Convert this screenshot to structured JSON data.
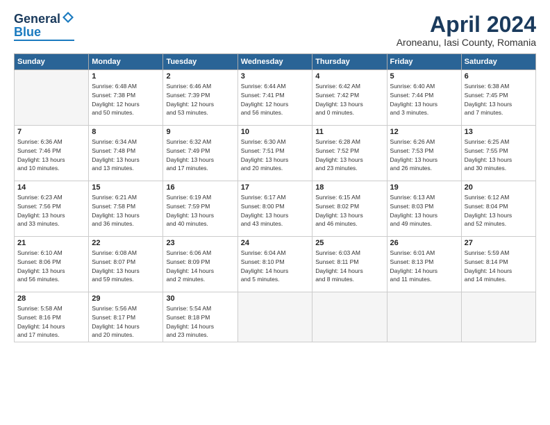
{
  "logo": {
    "general": "General",
    "blue": "Blue"
  },
  "header": {
    "title": "April 2024",
    "subtitle": "Aroneanu, Iasi County, Romania"
  },
  "days_of_week": [
    "Sunday",
    "Monday",
    "Tuesday",
    "Wednesday",
    "Thursday",
    "Friday",
    "Saturday"
  ],
  "weeks": [
    [
      {
        "day": "",
        "info": ""
      },
      {
        "day": "1",
        "info": "Sunrise: 6:48 AM\nSunset: 7:38 PM\nDaylight: 12 hours\nand 50 minutes."
      },
      {
        "day": "2",
        "info": "Sunrise: 6:46 AM\nSunset: 7:39 PM\nDaylight: 12 hours\nand 53 minutes."
      },
      {
        "day": "3",
        "info": "Sunrise: 6:44 AM\nSunset: 7:41 PM\nDaylight: 12 hours\nand 56 minutes."
      },
      {
        "day": "4",
        "info": "Sunrise: 6:42 AM\nSunset: 7:42 PM\nDaylight: 13 hours\nand 0 minutes."
      },
      {
        "day": "5",
        "info": "Sunrise: 6:40 AM\nSunset: 7:44 PM\nDaylight: 13 hours\nand 3 minutes."
      },
      {
        "day": "6",
        "info": "Sunrise: 6:38 AM\nSunset: 7:45 PM\nDaylight: 13 hours\nand 7 minutes."
      }
    ],
    [
      {
        "day": "7",
        "info": "Sunrise: 6:36 AM\nSunset: 7:46 PM\nDaylight: 13 hours\nand 10 minutes."
      },
      {
        "day": "8",
        "info": "Sunrise: 6:34 AM\nSunset: 7:48 PM\nDaylight: 13 hours\nand 13 minutes."
      },
      {
        "day": "9",
        "info": "Sunrise: 6:32 AM\nSunset: 7:49 PM\nDaylight: 13 hours\nand 17 minutes."
      },
      {
        "day": "10",
        "info": "Sunrise: 6:30 AM\nSunset: 7:51 PM\nDaylight: 13 hours\nand 20 minutes."
      },
      {
        "day": "11",
        "info": "Sunrise: 6:28 AM\nSunset: 7:52 PM\nDaylight: 13 hours\nand 23 minutes."
      },
      {
        "day": "12",
        "info": "Sunrise: 6:26 AM\nSunset: 7:53 PM\nDaylight: 13 hours\nand 26 minutes."
      },
      {
        "day": "13",
        "info": "Sunrise: 6:25 AM\nSunset: 7:55 PM\nDaylight: 13 hours\nand 30 minutes."
      }
    ],
    [
      {
        "day": "14",
        "info": "Sunrise: 6:23 AM\nSunset: 7:56 PM\nDaylight: 13 hours\nand 33 minutes."
      },
      {
        "day": "15",
        "info": "Sunrise: 6:21 AM\nSunset: 7:58 PM\nDaylight: 13 hours\nand 36 minutes."
      },
      {
        "day": "16",
        "info": "Sunrise: 6:19 AM\nSunset: 7:59 PM\nDaylight: 13 hours\nand 40 minutes."
      },
      {
        "day": "17",
        "info": "Sunrise: 6:17 AM\nSunset: 8:00 PM\nDaylight: 13 hours\nand 43 minutes."
      },
      {
        "day": "18",
        "info": "Sunrise: 6:15 AM\nSunset: 8:02 PM\nDaylight: 13 hours\nand 46 minutes."
      },
      {
        "day": "19",
        "info": "Sunrise: 6:13 AM\nSunset: 8:03 PM\nDaylight: 13 hours\nand 49 minutes."
      },
      {
        "day": "20",
        "info": "Sunrise: 6:12 AM\nSunset: 8:04 PM\nDaylight: 13 hours\nand 52 minutes."
      }
    ],
    [
      {
        "day": "21",
        "info": "Sunrise: 6:10 AM\nSunset: 8:06 PM\nDaylight: 13 hours\nand 56 minutes."
      },
      {
        "day": "22",
        "info": "Sunrise: 6:08 AM\nSunset: 8:07 PM\nDaylight: 13 hours\nand 59 minutes."
      },
      {
        "day": "23",
        "info": "Sunrise: 6:06 AM\nSunset: 8:09 PM\nDaylight: 14 hours\nand 2 minutes."
      },
      {
        "day": "24",
        "info": "Sunrise: 6:04 AM\nSunset: 8:10 PM\nDaylight: 14 hours\nand 5 minutes."
      },
      {
        "day": "25",
        "info": "Sunrise: 6:03 AM\nSunset: 8:11 PM\nDaylight: 14 hours\nand 8 minutes."
      },
      {
        "day": "26",
        "info": "Sunrise: 6:01 AM\nSunset: 8:13 PM\nDaylight: 14 hours\nand 11 minutes."
      },
      {
        "day": "27",
        "info": "Sunrise: 5:59 AM\nSunset: 8:14 PM\nDaylight: 14 hours\nand 14 minutes."
      }
    ],
    [
      {
        "day": "28",
        "info": "Sunrise: 5:58 AM\nSunset: 8:16 PM\nDaylight: 14 hours\nand 17 minutes."
      },
      {
        "day": "29",
        "info": "Sunrise: 5:56 AM\nSunset: 8:17 PM\nDaylight: 14 hours\nand 20 minutes."
      },
      {
        "day": "30",
        "info": "Sunrise: 5:54 AM\nSunset: 8:18 PM\nDaylight: 14 hours\nand 23 minutes."
      },
      {
        "day": "",
        "info": ""
      },
      {
        "day": "",
        "info": ""
      },
      {
        "day": "",
        "info": ""
      },
      {
        "day": "",
        "info": ""
      }
    ]
  ]
}
